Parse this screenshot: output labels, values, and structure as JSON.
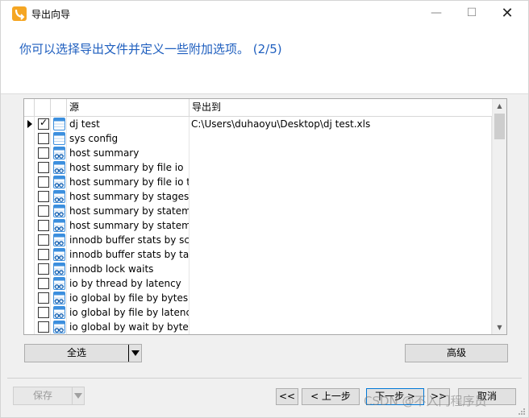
{
  "window": {
    "title": "导出向导",
    "minimize": "—",
    "maximize": "☐",
    "close": "✕"
  },
  "header": {
    "text": "你可以选择导出文件并定义一些附加选项。 (2/5)"
  },
  "grid": {
    "columns": [
      "源",
      "导出到"
    ],
    "rows": [
      {
        "source": "dj test",
        "dest": "C:\\Users\\duhaoyu\\Desktop\\dj test.xls",
        "checked": true,
        "current": true,
        "icon": "table-icon"
      },
      {
        "source": "sys config",
        "dest": "",
        "checked": false,
        "current": false,
        "icon": "table-icon"
      },
      {
        "source": "host summary",
        "dest": "",
        "checked": false,
        "current": false,
        "icon": "view-icon"
      },
      {
        "source": "host summary by file io",
        "dest": "",
        "checked": false,
        "current": false,
        "icon": "view-icon"
      },
      {
        "source": "host summary by file io t",
        "dest": "",
        "checked": false,
        "current": false,
        "icon": "view-icon"
      },
      {
        "source": "host summary by stages",
        "dest": "",
        "checked": false,
        "current": false,
        "icon": "view-icon"
      },
      {
        "source": "host summary by stateme",
        "dest": "",
        "checked": false,
        "current": false,
        "icon": "view-icon"
      },
      {
        "source": "host summary by stateme",
        "dest": "",
        "checked": false,
        "current": false,
        "icon": "view-icon"
      },
      {
        "source": "innodb buffer stats by sc",
        "dest": "",
        "checked": false,
        "current": false,
        "icon": "view-icon"
      },
      {
        "source": "innodb buffer stats by ta",
        "dest": "",
        "checked": false,
        "current": false,
        "icon": "view-icon"
      },
      {
        "source": "innodb lock waits",
        "dest": "",
        "checked": false,
        "current": false,
        "icon": "view-icon"
      },
      {
        "source": "io by thread by latency",
        "dest": "",
        "checked": false,
        "current": false,
        "icon": "view-icon"
      },
      {
        "source": "io global by file by bytes",
        "dest": "",
        "checked": false,
        "current": false,
        "icon": "view-icon"
      },
      {
        "source": "io global by file by latenc",
        "dest": "",
        "checked": false,
        "current": false,
        "icon": "view-icon"
      },
      {
        "source": "io global by wait by byte",
        "dest": "",
        "checked": false,
        "current": false,
        "icon": "view-icon"
      }
    ]
  },
  "buttons": {
    "select_all": "全选",
    "advanced": "高级",
    "save": "保存",
    "first": "<<",
    "prev": "< 上一步",
    "next": "下一步 >",
    "last": ">>",
    "cancel": "取消"
  },
  "watermark": "CSDN @不入门程序员",
  "colors": {
    "header_text": "#1f5fbf",
    "table_icon": "#3c8fde",
    "next_border": "#0078d7"
  }
}
